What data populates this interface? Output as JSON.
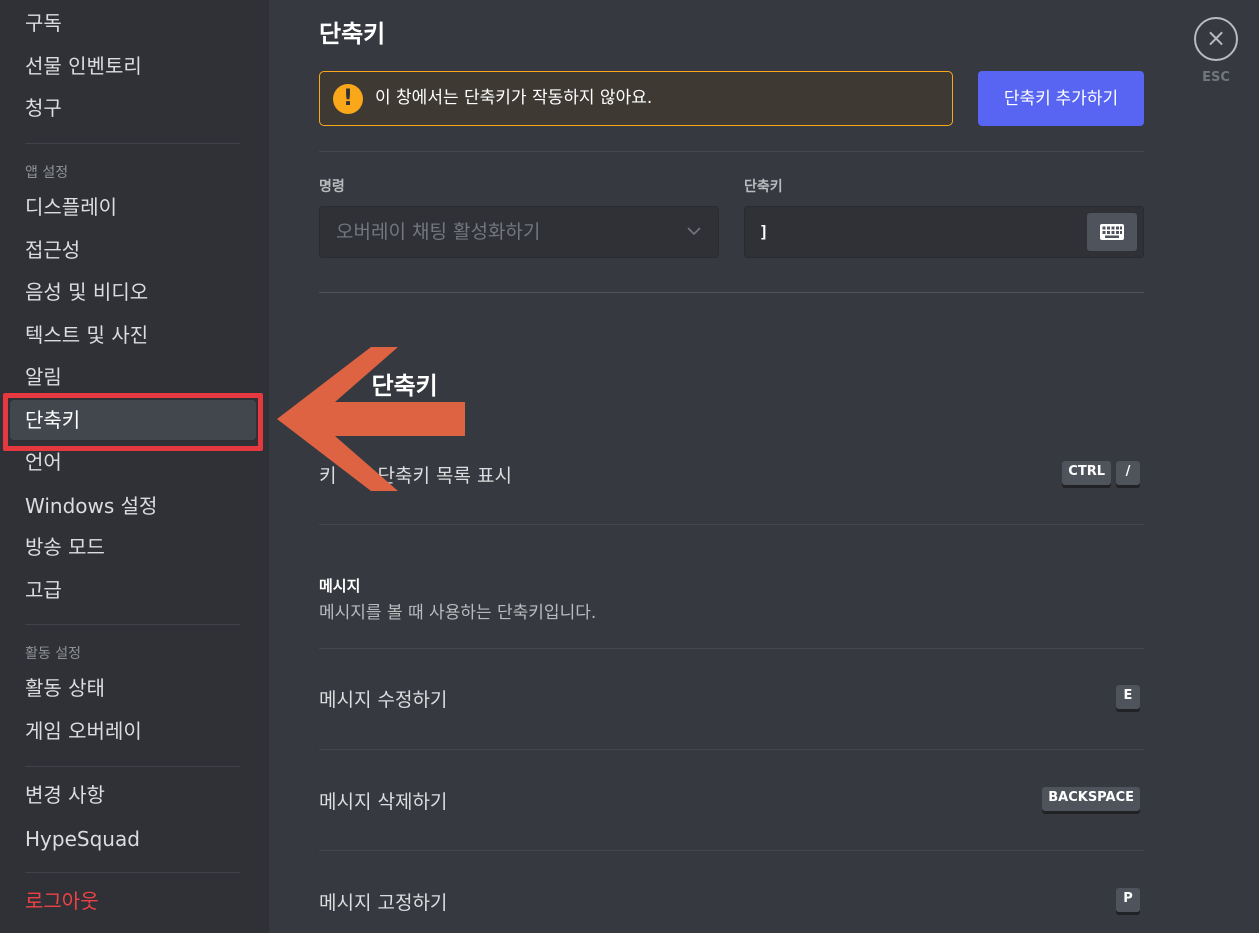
{
  "sidebar": {
    "items_top": [
      {
        "label": "구독"
      },
      {
        "label": "선물 인벤토리"
      },
      {
        "label": "청구"
      }
    ],
    "app_settings_header": "앱 설정",
    "app_settings_items": [
      {
        "label": "디스플레이"
      },
      {
        "label": "접근성"
      },
      {
        "label": "음성 및 비디오"
      },
      {
        "label": "텍스트 및 사진"
      },
      {
        "label": "알림"
      },
      {
        "label": "단축키"
      },
      {
        "label": "언어"
      },
      {
        "label": "Windows 설정"
      },
      {
        "label": "방송 모드"
      },
      {
        "label": "고급"
      }
    ],
    "activity_header": "활동 설정",
    "activity_items": [
      {
        "label": "활동 상태"
      },
      {
        "label": "게임 오버레이"
      }
    ],
    "misc_items": [
      {
        "label": "변경 사항"
      },
      {
        "label": "HypeSquad"
      }
    ],
    "logout": "로그아웃",
    "selected": "단축키"
  },
  "main": {
    "title": "단축키",
    "warning_text": "이 창에서는 단축키가 작동하지 않아요.",
    "warning_icon": "!",
    "add_button": "단축키 추가하기",
    "command_label": "명령",
    "command_value": "오버레이 채팅 활성화하기",
    "keybind_label": "단축키",
    "keybind_value": "]",
    "default_section_title_visible": "단축키",
    "row_keyboard": {
      "label_visible_left": "키",
      "label_visible_right": "단축키 목록 표시",
      "keys": [
        "CTRL",
        "/"
      ]
    },
    "messages_section": {
      "title": "메시지",
      "description": "메시지를 볼 때 사용하는 단축키입니다."
    },
    "rows": [
      {
        "label": "메시지 수정하기",
        "keys": [
          "E"
        ]
      },
      {
        "label": "메시지 삭제하기",
        "keys": [
          "BACKSPACE"
        ]
      },
      {
        "label": "메시지 고정하기",
        "keys": [
          "P"
        ]
      }
    ]
  },
  "close": {
    "icon": "×",
    "label": "ESC"
  },
  "colors": {
    "accent": "#5865f2",
    "warning": "#faa81a",
    "danger": "#ed4245",
    "annotation": "#e6393f",
    "arrow": "#de6342"
  }
}
